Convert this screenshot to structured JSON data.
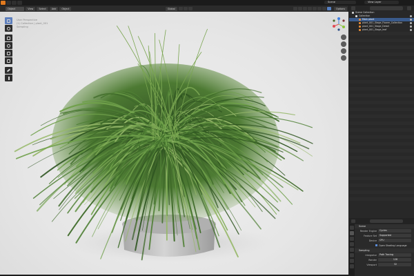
{
  "topbar": {
    "scene_label": "Scene",
    "view_layer_label": "View Layer"
  },
  "viewport_header": {
    "mode": "Object Mode",
    "view": "View",
    "select": "Select",
    "add": "Add",
    "object": "Object",
    "orientation": "Global",
    "options": "Options"
  },
  "overlay": {
    "line1": "User Perspective",
    "line2": "(1) Collection | plant_001",
    "line3": "Sampling"
  },
  "outliner": {
    "search_placeholder": "",
    "items": [
      {
        "label": "Scene Collection",
        "selected": false
      },
      {
        "label": "Collection",
        "selected": false
      },
      {
        "label": "Main plant",
        "selected": true
      },
      {
        "label": "plant_001_Stage_Flower_Collection",
        "selected": false
      },
      {
        "label": "plant_001_Stage_Detail",
        "selected": false
      },
      {
        "label": "plant_001_Stage_leaf",
        "selected": false
      }
    ]
  },
  "properties": {
    "section_title": "Scene",
    "render_engine_label": "Render Engine",
    "render_engine_value": "Cycles",
    "feature_set_label": "Feature Set",
    "feature_set_value": "Supported",
    "device_label": "Device",
    "device_value": "CPU",
    "osl_label": "Open Shading Language",
    "sampling_label": "Sampling",
    "integrator_label": "Integrator",
    "integrator_value": "Path Tracing",
    "render_label": "Render",
    "render_value": "128",
    "viewport_label": "Viewport",
    "viewport_value": "32"
  },
  "colors": {
    "accent": "#5680c2",
    "selected_row": "#3a5b8c",
    "active_orange": "#e07a1f",
    "gizmo_x": "#e24a52",
    "gizmo_y": "#8ac33a",
    "gizmo_z": "#3f7fe0"
  }
}
